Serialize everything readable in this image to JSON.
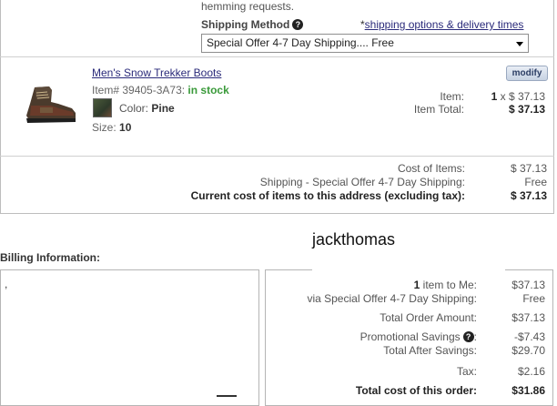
{
  "shipping": {
    "hemming_note": "hemming requests.",
    "method_label": "Shipping Method",
    "options_prefix": "*",
    "options_link": "shipping options & delivery times",
    "selected_option": "Special Offer 4-7 Day Shipping.... Free"
  },
  "product": {
    "name": "Men's Snow Trekker Boots",
    "item_prefix": "Item# 39405-3A73:",
    "stock_status": "in stock",
    "color_label": "Color:",
    "color_value": "Pine",
    "size_label": "Size:",
    "size_value": "10",
    "modify_label": "modify",
    "item_label": "Item:",
    "item_qty": "1",
    "item_price": " x $ 37.13",
    "item_total_label": "Item Total:",
    "item_total_value": "$ 37.13"
  },
  "address_costs": {
    "cost_of_items_label": "Cost of Items:",
    "cost_of_items_value": "$ 37.13",
    "shipping_label": "Shipping - Special Offer 4-7 Day Shipping:",
    "shipping_value": "Free",
    "current_cost_label": "Current cost of items to this address (excluding tax):",
    "current_cost_value": "$ 37.13"
  },
  "username": "jackthomas",
  "billing": {
    "title": "Billing Information:",
    "address_text": ","
  },
  "summary": {
    "items_count": "1",
    "items_label": " item to Me:",
    "items_value": "$37.13",
    "shipping_label": "via Special Offer 4-7 Day Shipping:",
    "shipping_value": "Free",
    "total_order_label": "Total Order Amount:",
    "total_order_value": "$37.13",
    "promo_label": "Promotional Savings",
    "promo_colon": ":",
    "promo_value": "-$7.43",
    "after_savings_label": "Total After Savings:",
    "after_savings_value": "$29.70",
    "tax_label": "Tax:",
    "tax_value": "$2.16",
    "total_label": "Total cost of this order:",
    "total_value": "$31.86"
  },
  "colors": {
    "stock_green": "#3a9a3a",
    "link_blue": "#2a2a7a",
    "border_gray": "#bdbdbd"
  }
}
